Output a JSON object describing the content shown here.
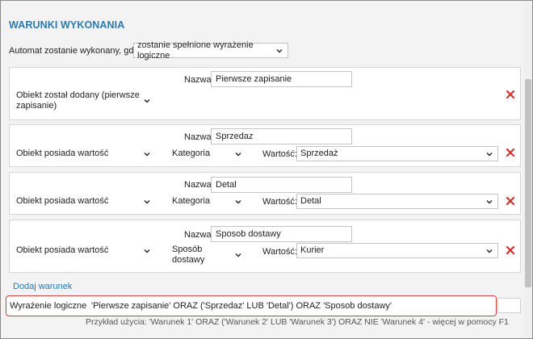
{
  "section_title": "WARUNKI WYKONANIA",
  "trigger": {
    "label": "Automat zostanie wykonany, gdy",
    "selected": "zostanie spełnione wyrażenie logiczne"
  },
  "conditions": [
    {
      "name_label": "Nazwa:",
      "name_value": "Pierwsze zapisanie",
      "type_line1": "Obiekt został dodany (pierwsze",
      "type_line2": "zapisanie)"
    },
    {
      "name_label": "Nazwa:",
      "name_value": "Sprzedaz",
      "type": "Obiekt posiada wartość",
      "attribute": "Kategoria",
      "value_label": "Wartość:",
      "value": "Sprzedaż"
    },
    {
      "name_label": "Nazwa:",
      "name_value": "Detal",
      "type": "Obiekt posiada wartość",
      "attribute": "Kategoria",
      "value_label": "Wartość:",
      "value": "Detal"
    },
    {
      "name_label": "Nazwa:",
      "name_value": "Sposob dostawy",
      "type": "Obiekt posiada wartość",
      "attribute_line1": "Sposób",
      "attribute_line2": "dostawy",
      "value_label": "Wartość:",
      "value": "Kurier"
    }
  ],
  "add_condition_label": "Dodaj warunek",
  "expression": {
    "label": "Wyrażenie logiczne:",
    "value": "'Pierwsze zapisanie' ORAZ ('Sprzedaz' LUB 'Detal') ORAZ 'Sposob dostawy'"
  },
  "hint": "Przykład użycia: 'Warunek 1' ORAZ ('Warunek 2' LUB 'Warunek 3') ORAZ NIE 'Warunek 4' - więcej w pomocy F1",
  "colors": {
    "accent": "#2a7ab0",
    "delete": "#d0312d",
    "highlight": "#d13b3b"
  },
  "icons": {
    "dropdown": "chevron-down-icon",
    "delete": "close-icon"
  }
}
